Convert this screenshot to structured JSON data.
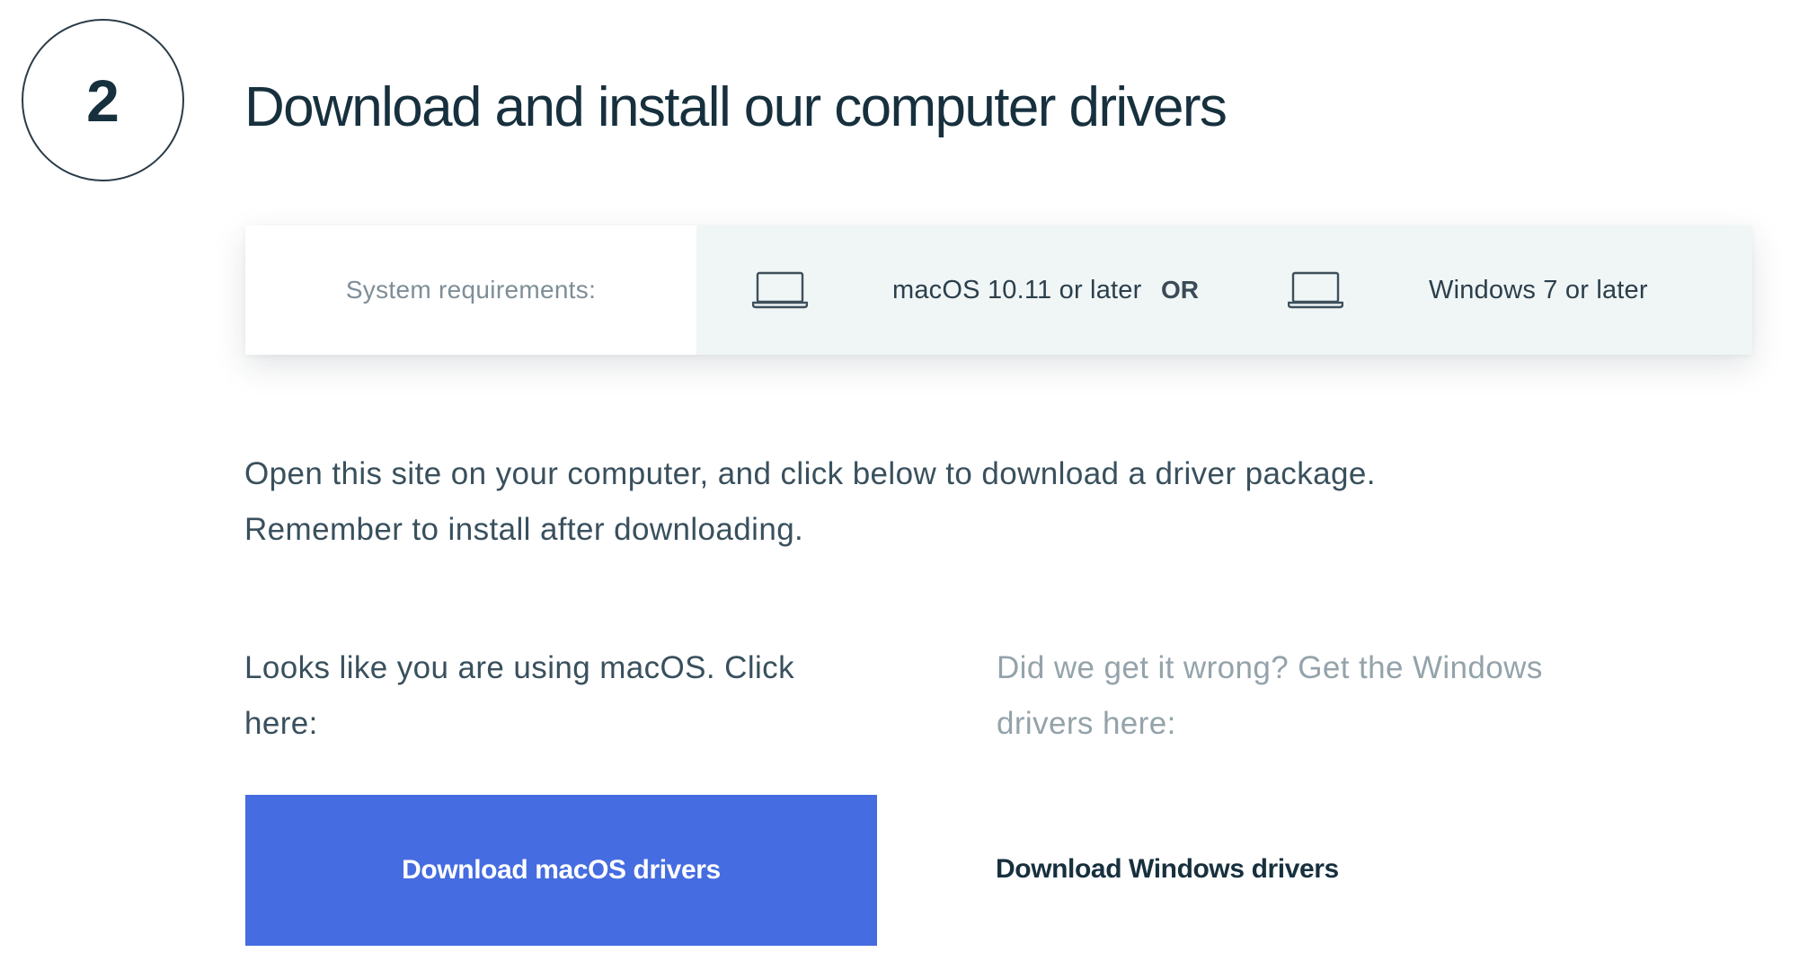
{
  "step": {
    "number": "2",
    "title": "Download and install our computer drivers"
  },
  "requirements": {
    "label": "System requirements:",
    "options": [
      {
        "icon": "laptop-icon",
        "text": "macOS 10.11 or later"
      },
      {
        "icon": "laptop-icon",
        "text": "Windows 7 or later"
      }
    ],
    "separator": "OR"
  },
  "instructions": {
    "line1": "Open this site on your computer, and click below to download a driver package.",
    "line2": "Remember to install after downloading."
  },
  "detected": {
    "text": "Looks like you are using macOS. Click here:",
    "button_label": "Download macOS drivers"
  },
  "alternative": {
    "text": "Did we get it wrong? Get the Windows drivers here:",
    "link_label": "Download Windows drivers"
  },
  "colors": {
    "primary_button": "#456ce0",
    "heading": "#17303e",
    "muted_text": "#94a3aa",
    "options_background": "#f0f5f6"
  }
}
